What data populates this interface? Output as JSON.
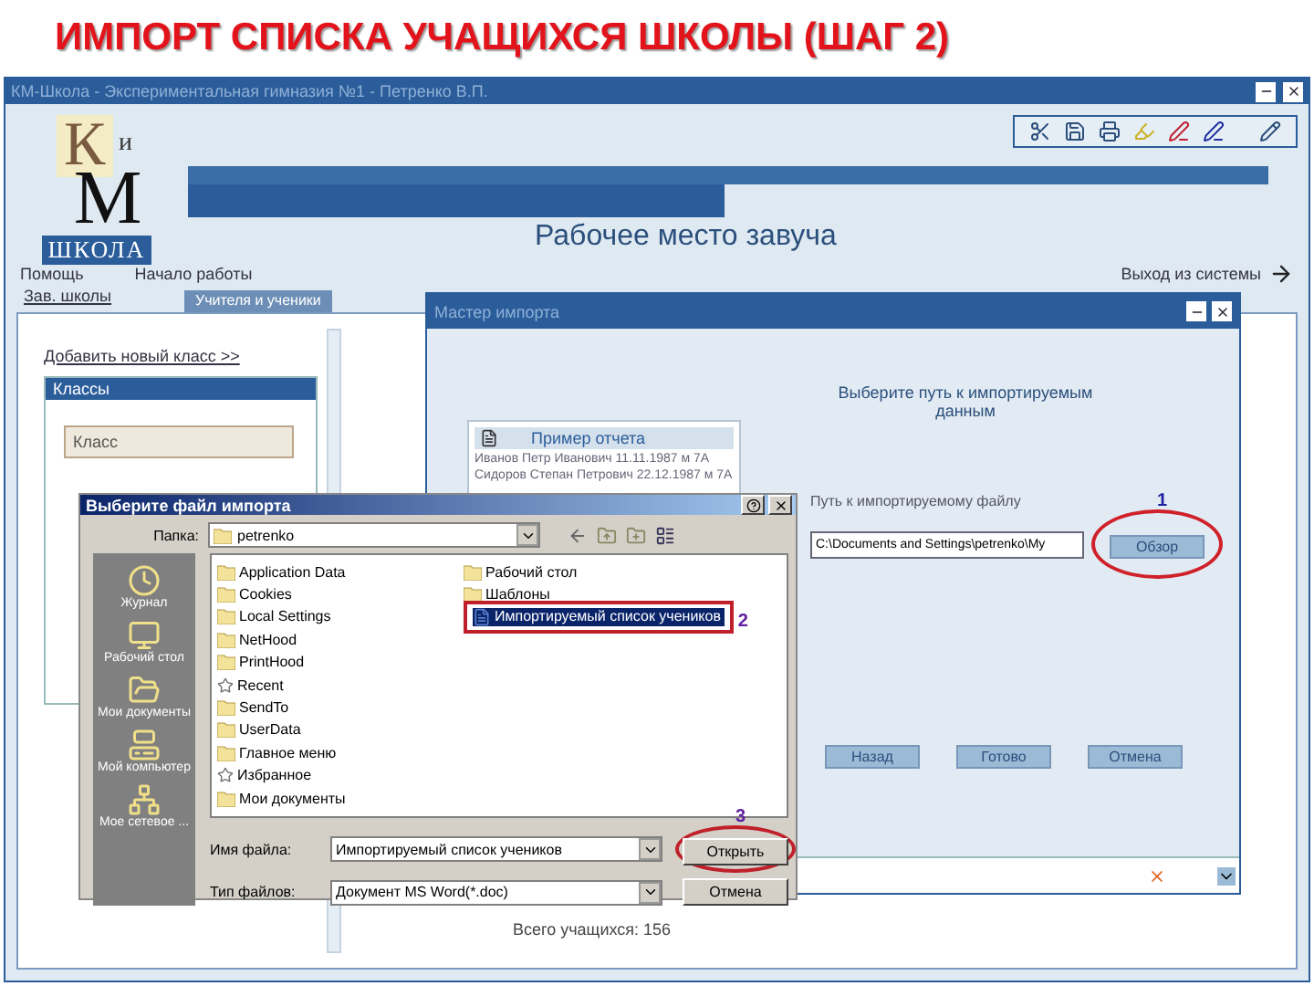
{
  "slide_title": "ИМПОРТ СПИСКА УЧАЩИХСЯ ШКОЛЫ (ШАГ 2)",
  "app": {
    "title": "КМ-Школа - Экспериментальная гимназия №1 - Петренко В.П.",
    "logo": {
      "top": "К",
      "small": "и",
      "big": "М",
      "caption": "ШКОЛА"
    },
    "page_title": "Рабочее место завуча",
    "nav": [
      "Помощь",
      "Начало работы"
    ],
    "exit_link": "Выход из системы",
    "section_link": "Зав. школы",
    "tab": "Учителя и ученики",
    "add_link": "Добавить новый класс >>",
    "classes_panel": {
      "title": "Классы",
      "column": "Класс"
    },
    "total": "Всего учащихся: 156"
  },
  "wizard": {
    "title": "Мастер импорта",
    "example": {
      "title": "Пример отчета",
      "rows": [
        "Иванов Петр Иванович 11.11.1987 м 7А",
        "Сидоров Степан Петрович 22.12.1987 м 7А"
      ]
    },
    "prompt": "Выберите путь к импортируемым данным",
    "path_label": "Путь к импортируемому файлу",
    "path_value": "C:\\Documents and Settings\\petrenko\\My",
    "browse_button": "Обзор",
    "browse_callout": "1",
    "buttons": [
      "Назад",
      "Готово",
      "Отмена"
    ]
  },
  "file_dialog": {
    "title": "Выберите файл импорта",
    "folder_label": "Папка:",
    "folder": "petrenko",
    "places": [
      {
        "label": "Журнал",
        "kind": "history"
      },
      {
        "label": "Рабочий стол",
        "kind": "desktop"
      },
      {
        "label": "Мои документы",
        "kind": "documents"
      },
      {
        "label": "Мой компьютер",
        "kind": "computer"
      },
      {
        "label": "Мое сетевое ...",
        "kind": "network"
      }
    ],
    "files": [
      {
        "name": "Application Data",
        "kind": "folder",
        "selected": false
      },
      {
        "name": "Cookies",
        "kind": "folder",
        "selected": false
      },
      {
        "name": "Local Settings",
        "kind": "folder",
        "selected": false
      },
      {
        "name": "NetHood",
        "kind": "folder",
        "selected": false
      },
      {
        "name": "PrintHood",
        "kind": "folder",
        "selected": false
      },
      {
        "name": "Recent",
        "kind": "special",
        "selected": false
      },
      {
        "name": "SendTo",
        "kind": "folder",
        "selected": false
      },
      {
        "name": "UserData",
        "kind": "folder",
        "selected": false
      },
      {
        "name": "Главное меню",
        "kind": "folder",
        "selected": false
      },
      {
        "name": "Избранное",
        "kind": "special",
        "selected": false
      },
      {
        "name": "Мои документы",
        "kind": "folder",
        "selected": false
      },
      {
        "name": "Рабочий стол",
        "kind": "folder",
        "selected": false
      },
      {
        "name": "Шаблоны",
        "kind": "folder",
        "selected": false
      },
      {
        "name": "Импортируемый список учеников",
        "kind": "document",
        "selected": true
      }
    ],
    "selected_callout": "2",
    "filename_label": "Имя файла:",
    "filename": "Импортируемый список учеников",
    "type_label": "Тип файлов:",
    "type": "Документ MS Word(*.doc)",
    "open_button": "Открыть",
    "open_callout": "3",
    "cancel_button": "Отмена"
  }
}
